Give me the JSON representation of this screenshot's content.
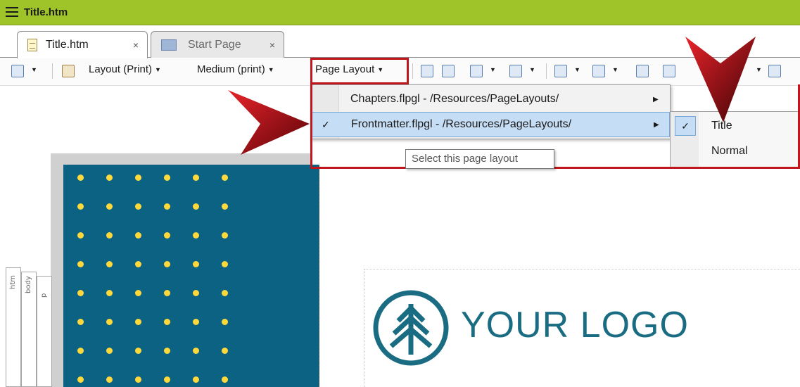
{
  "window": {
    "title": "Title.htm"
  },
  "tabs": [
    {
      "label": "Title.htm",
      "close": "×"
    },
    {
      "label": "Start Page",
      "close": "×"
    }
  ],
  "toolbar": {
    "layout": "Layout (Print)",
    "medium": "Medium (print)",
    "page_layout": "Page Layout"
  },
  "dropdown": {
    "items": [
      {
        "label": "Chapters.flpgl - /Resources/PageLayouts/",
        "checked": false
      },
      {
        "label": "Frontmatter.flpgl - /Resources/PageLayouts/",
        "checked": true
      }
    ],
    "check": "✓"
  },
  "submenu": {
    "items": [
      {
        "label": "Title",
        "checked": true
      },
      {
        "label": "Normal",
        "checked": false
      }
    ],
    "check": "✓"
  },
  "tooltip": "Select this page layout",
  "structure_tabs": [
    "htm",
    "body",
    "p"
  ],
  "logo_text": "YOUR LOGO",
  "colors": {
    "titlebar": "#9ec42a",
    "highlight": "#c0161e",
    "page_bg": "#0b6283",
    "dots": "#ffd93c",
    "logo": "#1a6c82"
  }
}
